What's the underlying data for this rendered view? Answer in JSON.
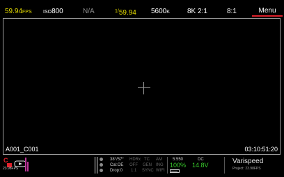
{
  "top": {
    "fps_value": "59.94",
    "fps_unit": "FPS",
    "iso_label": "ISO",
    "iso_value": "800",
    "aperture": "N/A",
    "shutter_prefix": "1/",
    "shutter_value": "59.94",
    "wb_value": "5600",
    "wb_unit": "K",
    "resolution": "8K 2:1",
    "compression": "8:1",
    "menu_label": "Menu"
  },
  "viewport": {
    "clip_name": "A001_C001",
    "timecode": "03:10:51:20"
  },
  "bottom": {
    "rec_fps": "23.98FPS",
    "status": {
      "r1": [
        "38°/57°",
        "HDRx",
        "TC",
        "AM"
      ],
      "r2": [
        "Cal:OE",
        "OFF",
        "GEN",
        "ING"
      ],
      "r3": [
        "Drop:0",
        "1:1",
        "SYNC",
        "WIFI"
      ]
    },
    "media_label": "5:550",
    "media_percent": "100%",
    "dc_label": "DC",
    "dc_value": "14.8V",
    "mode": "Varispeed",
    "project": "Project: 23.98FPS"
  },
  "colors": {
    "yellow": "#e8df00",
    "green": "#3ad12d",
    "red": "#e0202a",
    "magenta": "#c0369a"
  }
}
